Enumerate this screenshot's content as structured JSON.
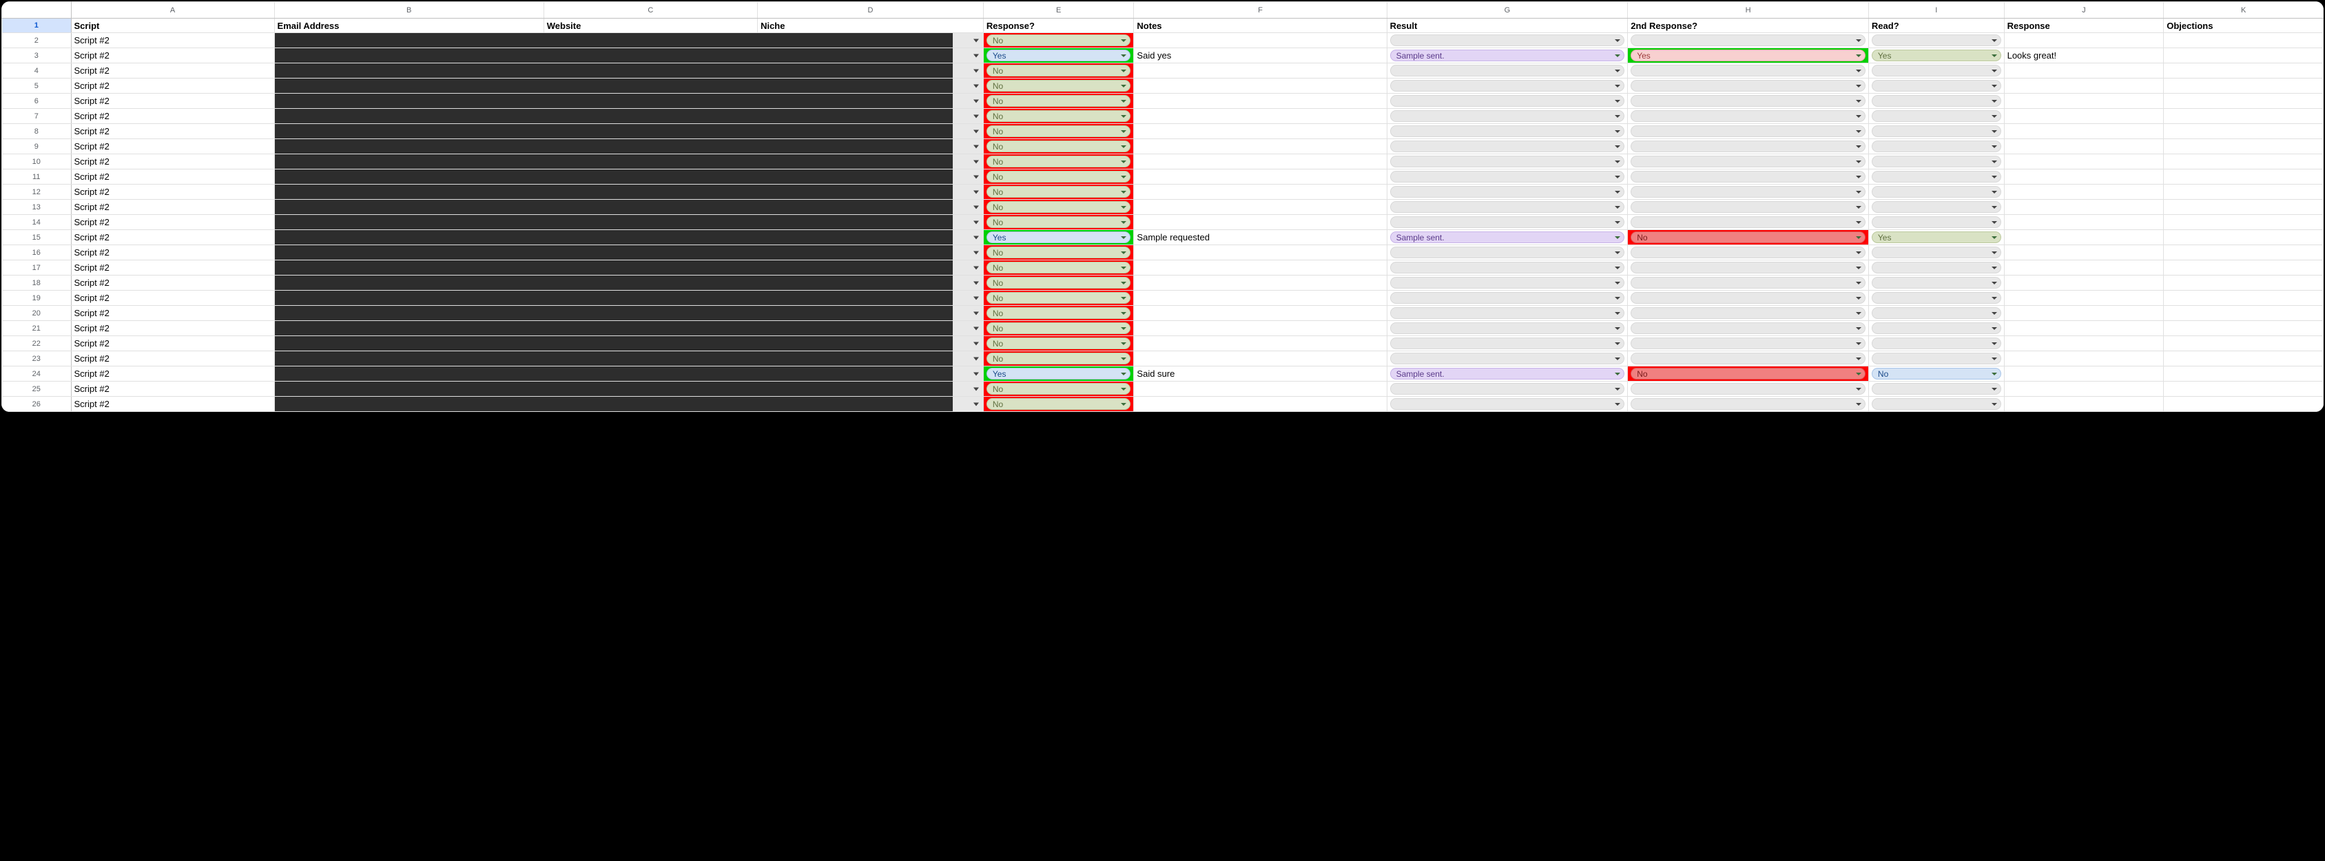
{
  "columns": [
    "",
    "A",
    "B",
    "C",
    "D",
    "E",
    "F",
    "G",
    "H",
    "I",
    "J",
    "K"
  ],
  "headers": {
    "A": "Script",
    "B": "Email Address",
    "C": "Website",
    "D": "Niche",
    "E": "Response?",
    "F": "Notes",
    "G": "Result",
    "H": "2nd Response?",
    "I": "Read?",
    "J": "Response",
    "K": "Objections"
  },
  "rows": [
    {
      "n": 2,
      "script": "Script #2",
      "response": "No",
      "resp_bg": "red",
      "notes": "",
      "result": "",
      "resp2": "",
      "resp2_bg": "",
      "read": "",
      "j": "",
      "k": ""
    },
    {
      "n": 3,
      "script": "Script #2",
      "response": "Yes",
      "resp_bg": "green",
      "resp_pill": "blue",
      "notes": "Said yes",
      "result": "Sample sent.",
      "resp2": "Yes",
      "resp2_bg": "green",
      "resp2_pill": "pink",
      "read": "Yes",
      "read_pill": "olive",
      "j": "Looks great!",
      "k": ""
    },
    {
      "n": 4,
      "script": "Script #2",
      "response": "No",
      "resp_bg": "red",
      "notes": "",
      "result": "",
      "resp2": "",
      "resp2_bg": "",
      "read": "",
      "j": "",
      "k": ""
    },
    {
      "n": 5,
      "script": "Script #2",
      "response": "No",
      "resp_bg": "red",
      "notes": "",
      "result": "",
      "resp2": "",
      "resp2_bg": "",
      "read": "",
      "j": "",
      "k": ""
    },
    {
      "n": 6,
      "script": "Script #2",
      "response": "No",
      "resp_bg": "red",
      "notes": "",
      "result": "",
      "resp2": "",
      "resp2_bg": "",
      "read": "",
      "j": "",
      "k": ""
    },
    {
      "n": 7,
      "script": "Script #2",
      "response": "No",
      "resp_bg": "red",
      "notes": "",
      "result": "",
      "resp2": "",
      "resp2_bg": "",
      "read": "",
      "j": "",
      "k": ""
    },
    {
      "n": 8,
      "script": "Script #2",
      "response": "No",
      "resp_bg": "red",
      "notes": "",
      "result": "",
      "resp2": "",
      "resp2_bg": "",
      "read": "",
      "j": "",
      "k": ""
    },
    {
      "n": 9,
      "script": "Script #2",
      "response": "No",
      "resp_bg": "red",
      "notes": "",
      "result": "",
      "resp2": "",
      "resp2_bg": "",
      "read": "",
      "j": "",
      "k": ""
    },
    {
      "n": 10,
      "script": "Script #2",
      "response": "No",
      "resp_bg": "red",
      "notes": "",
      "result": "",
      "resp2": "",
      "resp2_bg": "",
      "read": "",
      "j": "",
      "k": ""
    },
    {
      "n": 11,
      "script": "Script #2",
      "response": "No",
      "resp_bg": "red",
      "notes": "",
      "result": "",
      "resp2": "",
      "resp2_bg": "",
      "read": "",
      "j": "",
      "k": ""
    },
    {
      "n": 12,
      "script": "Script #2",
      "response": "No",
      "resp_bg": "red",
      "notes": "",
      "result": "",
      "resp2": "",
      "resp2_bg": "",
      "read": "",
      "j": "",
      "k": ""
    },
    {
      "n": 13,
      "script": "Script #2",
      "response": "No",
      "resp_bg": "red",
      "notes": "",
      "result": "",
      "resp2": "",
      "resp2_bg": "",
      "read": "",
      "j": "",
      "k": ""
    },
    {
      "n": 14,
      "script": "Script #2",
      "response": "No",
      "resp_bg": "red",
      "notes": "",
      "result": "",
      "resp2": "",
      "resp2_bg": "",
      "read": "",
      "j": "",
      "k": ""
    },
    {
      "n": 15,
      "script": "Script #2",
      "response": "Yes",
      "resp_bg": "green",
      "resp_pill": "blue",
      "notes": "Sample requested",
      "result": "Sample sent.",
      "resp2": "No",
      "resp2_bg": "red",
      "resp2_pill": "red",
      "read": "Yes",
      "read_pill": "olive",
      "j": "",
      "k": ""
    },
    {
      "n": 16,
      "script": "Script #2",
      "response": "No",
      "resp_bg": "red",
      "notes": "",
      "result": "",
      "resp2": "",
      "resp2_bg": "",
      "read": "",
      "j": "",
      "k": ""
    },
    {
      "n": 17,
      "script": "Script #2",
      "response": "No",
      "resp_bg": "red",
      "notes": "",
      "result": "",
      "resp2": "",
      "resp2_bg": "",
      "read": "",
      "j": "",
      "k": ""
    },
    {
      "n": 18,
      "script": "Script #2",
      "response": "No",
      "resp_bg": "red",
      "notes": "",
      "result": "",
      "resp2": "",
      "resp2_bg": "",
      "read": "",
      "j": "",
      "k": ""
    },
    {
      "n": 19,
      "script": "Script #2",
      "response": "No",
      "resp_bg": "red",
      "notes": "",
      "result": "",
      "resp2": "",
      "resp2_bg": "",
      "read": "",
      "j": "",
      "k": ""
    },
    {
      "n": 20,
      "script": "Script #2",
      "response": "No",
      "resp_bg": "red",
      "notes": "",
      "result": "",
      "resp2": "",
      "resp2_bg": "",
      "read": "",
      "j": "",
      "k": ""
    },
    {
      "n": 21,
      "script": "Script #2",
      "response": "No",
      "resp_bg": "red",
      "notes": "",
      "result": "",
      "resp2": "",
      "resp2_bg": "",
      "read": "",
      "j": "",
      "k": ""
    },
    {
      "n": 22,
      "script": "Script #2",
      "response": "No",
      "resp_bg": "red",
      "notes": "",
      "result": "",
      "resp2": "",
      "resp2_bg": "",
      "read": "",
      "j": "",
      "k": ""
    },
    {
      "n": 23,
      "script": "Script #2",
      "response": "No",
      "resp_bg": "red",
      "notes": "",
      "result": "",
      "resp2": "",
      "resp2_bg": "",
      "read": "",
      "j": "",
      "k": ""
    },
    {
      "n": 24,
      "script": "Script #2",
      "response": "Yes",
      "resp_bg": "green",
      "resp_pill": "blue",
      "notes": "Said sure",
      "result": "Sample sent.",
      "resp2": "No",
      "resp2_bg": "red",
      "resp2_pill": "red",
      "read": "No",
      "read_pill": "blue",
      "j": "",
      "k": ""
    },
    {
      "n": 25,
      "script": "Script #2",
      "response": "No",
      "resp_bg": "red",
      "notes": "",
      "result": "",
      "resp2": "",
      "resp2_bg": "",
      "read": "",
      "j": "",
      "k": ""
    },
    {
      "n": 26,
      "script": "Script #2",
      "response": "No",
      "resp_bg": "red",
      "notes": "",
      "result": "",
      "resp2": "",
      "resp2_bg": "",
      "read": "",
      "j": "",
      "k": ""
    }
  ]
}
